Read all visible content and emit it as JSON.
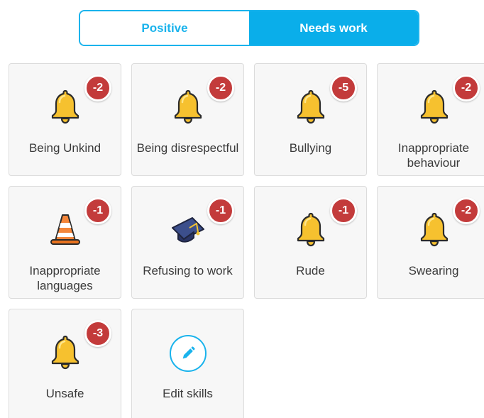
{
  "toggle": {
    "positive_label": "Positive",
    "needs_work_label": "Needs work",
    "active": "needs_work"
  },
  "colors": {
    "accent": "#1ab3ec",
    "badge": "#c33b3b",
    "card_bg": "#f7f7f7"
  },
  "skills": [
    {
      "label": "Being Unkind",
      "points": "-2",
      "icon": "bell-icon"
    },
    {
      "label": "Being disrespectful",
      "points": "-2",
      "icon": "bell-icon"
    },
    {
      "label": "Bullying",
      "points": "-5",
      "icon": "bell-icon"
    },
    {
      "label": "Inappropriate behaviour",
      "points": "-2",
      "icon": "bell-icon"
    },
    {
      "label": "Inappropriate languages",
      "points": "-1",
      "icon": "traffic-cone-icon"
    },
    {
      "label": "Refusing to work",
      "points": "-1",
      "icon": "graduation-cap-icon"
    },
    {
      "label": "Rude",
      "points": "-1",
      "icon": "bell-icon"
    },
    {
      "label": "Swearing",
      "points": "-2",
      "icon": "bell-icon"
    },
    {
      "label": "Unsafe",
      "points": "-3",
      "icon": "bell-icon"
    }
  ],
  "edit": {
    "label": "Edit skills",
    "icon": "pencil-icon"
  }
}
